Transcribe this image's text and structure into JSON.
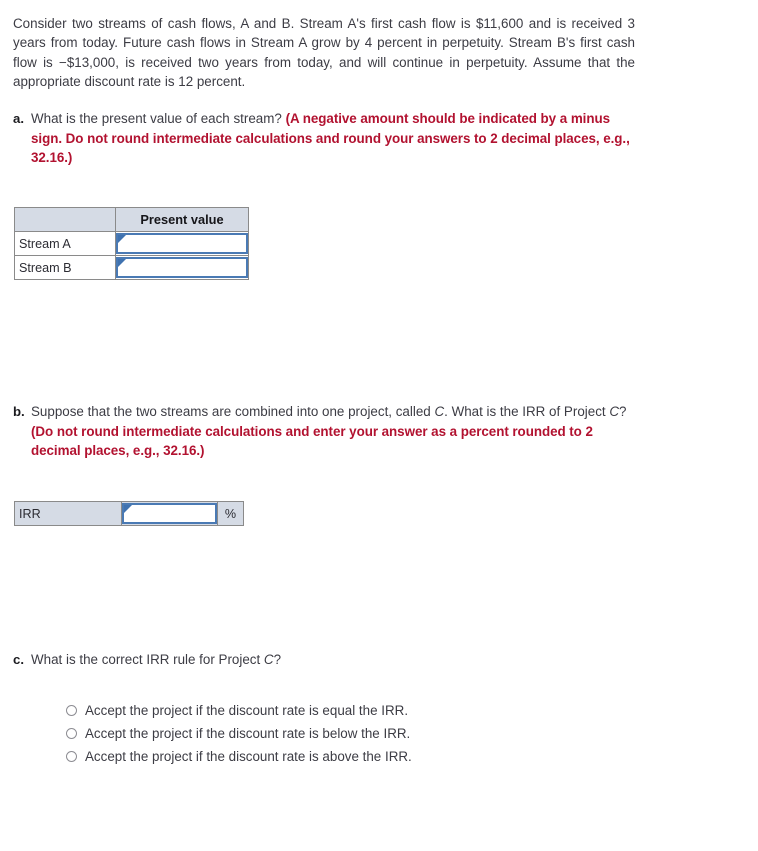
{
  "intro": {
    "text": "Consider two streams of cash flows, A and B. Stream A's first cash flow is $11,600 and is received 3 years from today. Future cash flows in Stream A grow by 4 percent in perpetuity. Stream B's first cash flow is −$13,000, is received two years from today, and will continue in perpetuity. Assume that the appropriate discount rate is 12 percent."
  },
  "parts": {
    "a": {
      "marker": "a.",
      "question": "What is the present value of each stream?",
      "instruction": "(A negative amount should be indicated by a minus sign. Do not round intermediate calculations and round your answers to 2 decimal places, e.g., 32.16.)"
    },
    "b": {
      "marker": "b.",
      "question_pre": "Suppose that the two streams are combined into one project, called ",
      "question_italic": "C",
      "question_mid": ". What is the IRR of Project ",
      "question_italic2": "C",
      "question_post": "? ",
      "instruction": "(Do not round intermediate calculations and enter your answer as a percent rounded to 2 decimal places, e.g., 32.16.)"
    },
    "c": {
      "marker": "c.",
      "question_pre": "What is the correct IRR rule for Project ",
      "question_italic": "C",
      "question_post": "?"
    }
  },
  "pv_table": {
    "header_blank": "",
    "header_label": "Present value",
    "rows": [
      {
        "label": "Stream A",
        "value": ""
      },
      {
        "label": "Stream B",
        "value": ""
      }
    ]
  },
  "irr_table": {
    "label": "IRR",
    "value": "",
    "unit": "%"
  },
  "options": [
    {
      "label": "Accept the project if the discount rate is equal the IRR.",
      "selected": false
    },
    {
      "label": "Accept the project if the discount rate is below the IRR.",
      "selected": false
    },
    {
      "label": "Accept the project if the discount rate is above the IRR.",
      "selected": false
    }
  ],
  "colors": {
    "instruction_red": "#b21230",
    "body_text": "#3c3c44",
    "table_header_fill": "#d5dbe5",
    "input_border_blue": "#4a7ab4",
    "corner_marker_blue": "#3f72b0",
    "table_border_gray": "#8a8a8a"
  }
}
